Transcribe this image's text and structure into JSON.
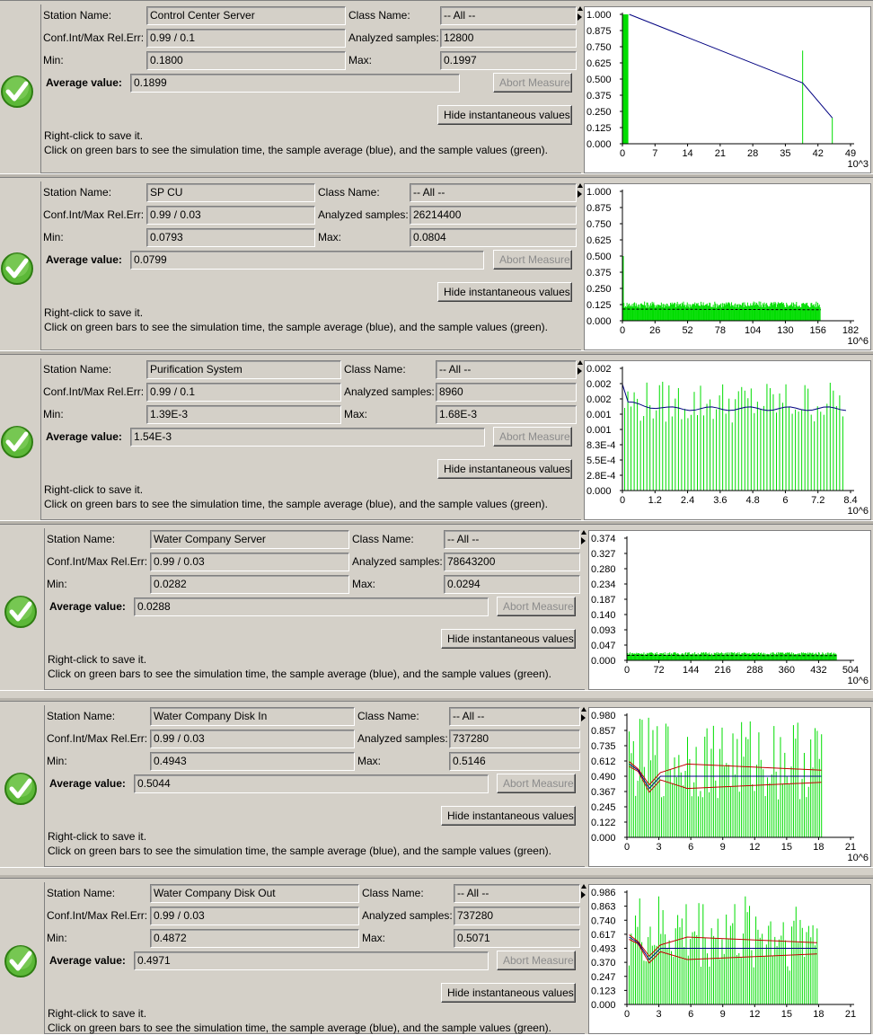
{
  "labels": {
    "station_name": "Station Name:",
    "class_name": "Class Name:",
    "conf_int": "Conf.Int/Max Rel.Err:",
    "analyzed_samples": "Analyzed samples:",
    "min": "Min:",
    "max": "Max:",
    "average_value": "Average value:",
    "abort_measure": "Abort Measure",
    "hide_instantaneous": "Hide instantaneous values",
    "hint_line1": "Right-click to save it.",
    "hint_line2": "Click on green bars to see the simulation time, the sample average (blue), and the sample values (green)."
  },
  "colors": {
    "sample_values": "#00dd00",
    "sample_average": "#000080",
    "confidence_bounds": "#c00000",
    "status_ok": "#3aa320"
  },
  "icons": {
    "status": "checkmark-icon"
  },
  "measures": [
    {
      "station": "Control Center Server",
      "class": "-- All --",
      "conf_int": "0.99 / 0.1",
      "samples": "12800",
      "min": "0.1800",
      "max": "0.1997",
      "average": "0.1899",
      "chart": {
        "y_ticks": [
          "1.000",
          "0.875",
          "0.750",
          "0.625",
          "0.500",
          "0.375",
          "0.250",
          "0.125",
          "0.000"
        ],
        "x_ticks": [
          "0",
          "7",
          "14",
          "21",
          "28",
          "35",
          "42",
          "49"
        ],
        "x_unit": "10^3"
      }
    },
    {
      "station": "SP CU",
      "class": "-- All --",
      "conf_int": "0.99 / 0.03",
      "samples": "26214400",
      "min": "0.0793",
      "max": "0.0804",
      "average": "0.0799",
      "chart": {
        "y_ticks": [
          "1.000",
          "0.875",
          "0.750",
          "0.625",
          "0.500",
          "0.375",
          "0.250",
          "0.125",
          "0.000"
        ],
        "x_ticks": [
          "0",
          "26",
          "52",
          "78",
          "104",
          "130",
          "156",
          "182"
        ],
        "x_unit": "10^6"
      }
    },
    {
      "station": "Purification System",
      "class": "-- All --",
      "conf_int": "0.99 / 0.1",
      "samples": "8960",
      "min": "1.39E-3",
      "max": "1.68E-3",
      "average": "1.54E-3",
      "chart": {
        "y_ticks": [
          "0.002",
          "0.002",
          "0.002",
          "0.001",
          "0.001",
          "8.3E-4",
          "5.5E-4",
          "2.8E-4",
          "0.000"
        ],
        "x_ticks": [
          "0",
          "1.2",
          "2.4",
          "3.6",
          "4.8",
          "6",
          "7.2",
          "8.4"
        ],
        "x_unit": "10^6"
      }
    },
    {
      "station": "Water Company Server",
      "class": "-- All --",
      "conf_int": "0.99 / 0.03",
      "samples": "78643200",
      "min": "0.0282",
      "max": "0.0294",
      "average": "0.0288",
      "chart": {
        "y_ticks": [
          "0.374",
          "0.327",
          "0.280",
          "0.234",
          "0.187",
          "0.140",
          "0.093",
          "0.047",
          "0.000"
        ],
        "x_ticks": [
          "0",
          "72",
          "144",
          "216",
          "288",
          "360",
          "432",
          "504"
        ],
        "x_unit": "10^6"
      }
    },
    {
      "station": "Water Company Disk In",
      "class": "-- All --",
      "conf_int": "0.99 / 0.03",
      "samples": "737280",
      "min": "0.4943",
      "max": "0.5146",
      "average": "0.5044",
      "chart": {
        "y_ticks": [
          "0.980",
          "0.857",
          "0.735",
          "0.612",
          "0.490",
          "0.367",
          "0.245",
          "0.122",
          "0.000"
        ],
        "x_ticks": [
          "0",
          "3",
          "6",
          "9",
          "12",
          "15",
          "18",
          "21"
        ],
        "x_unit": "10^6"
      }
    },
    {
      "station": "Water Company Disk Out",
      "class": "-- All --",
      "conf_int": "0.99 / 0.03",
      "samples": "737280",
      "min": "0.4872",
      "max": "0.5071",
      "average": "0.4971",
      "chart": {
        "y_ticks": [
          "0.986",
          "0.863",
          "0.740",
          "0.617",
          "0.493",
          "0.370",
          "0.247",
          "0.123",
          "0.000"
        ],
        "x_ticks": [
          "0",
          "3",
          "6",
          "9",
          "12",
          "15",
          "18",
          "21"
        ],
        "x_unit": ""
      }
    }
  ]
}
